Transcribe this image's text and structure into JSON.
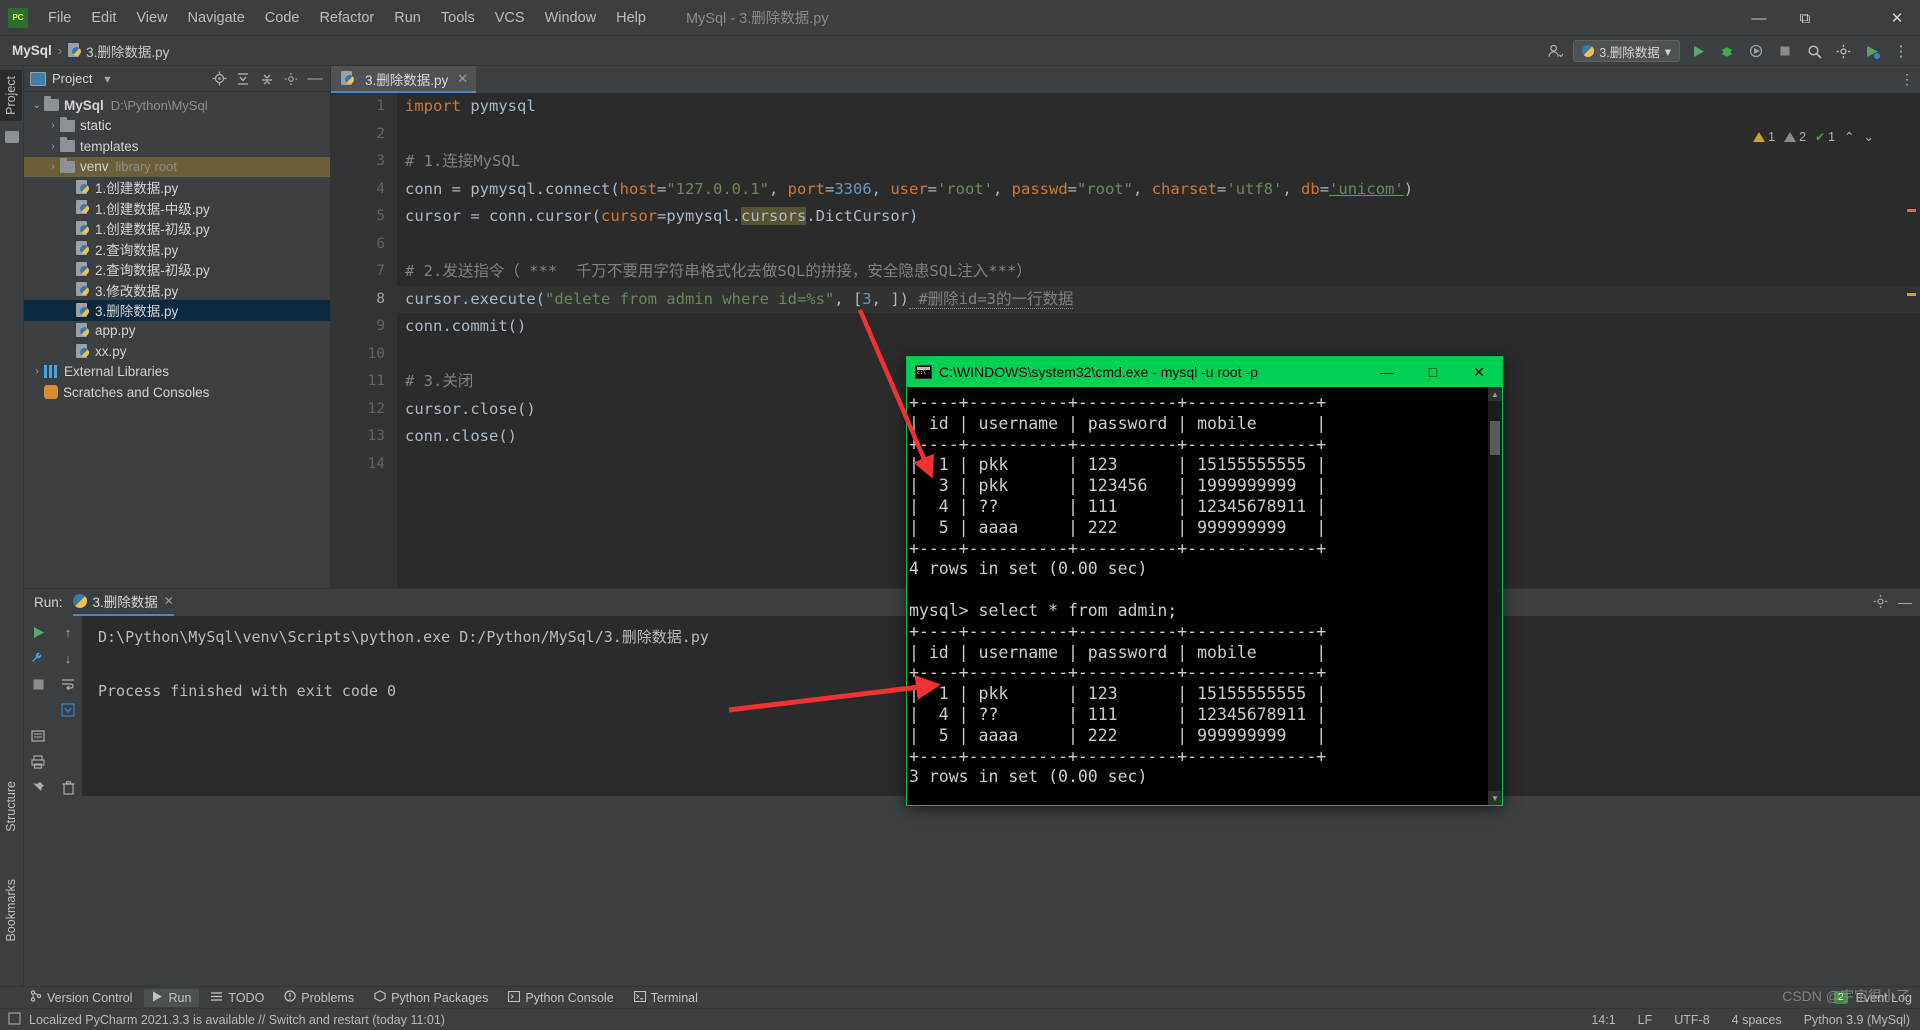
{
  "window": {
    "title": "MySql - 3.删除数据.py",
    "menu": [
      "File",
      "Edit",
      "View",
      "Navigate",
      "Code",
      "Refactor",
      "Run",
      "Tools",
      "VCS",
      "Window",
      "Help"
    ],
    "controls": {
      "minimize": "—",
      "maximize": "□",
      "restore": "⧉",
      "close": "✕"
    }
  },
  "navbar": {
    "breadcrumb_project": "MySql",
    "breadcrumb_sep": "›",
    "breadcrumb_file": "3.删除数据.py",
    "run_config": "3.删除数据",
    "run_config_caret": "▾",
    "icons": {
      "user": "user-icon",
      "run": "▶",
      "debug": "debug-icon",
      "coverage": "coverage-icon",
      "stop": "■",
      "search": "search-icon",
      "settings": "gear-icon",
      "updates": "updates-icon",
      "more": "⋮"
    }
  },
  "left_strip": {
    "tabs": [
      "Project"
    ]
  },
  "left_strip_bottom": {
    "tabs": [
      "Structure",
      "Bookmarks"
    ]
  },
  "project": {
    "title": "Project",
    "caret": "▾",
    "header_icons": [
      "locate-icon",
      "expand-all-icon",
      "collapse-all-icon",
      "settings-icon",
      "hide-icon"
    ],
    "tree": [
      {
        "indent": 0,
        "arrow": "⌄",
        "icon": "folder",
        "label": "MySql",
        "bold": true,
        "sub": "D:\\Python\\MySql",
        "state": "normal"
      },
      {
        "indent": 1,
        "arrow": "›",
        "icon": "folder",
        "label": "static",
        "bold": false,
        "sub": "",
        "state": "normal"
      },
      {
        "indent": 1,
        "arrow": "›",
        "icon": "folder",
        "label": "templates",
        "bold": false,
        "sub": "",
        "state": "normal"
      },
      {
        "indent": 1,
        "arrow": "›",
        "icon": "folder",
        "label": "venv",
        "bold": false,
        "sub": "library root",
        "state": "library"
      },
      {
        "indent": 2,
        "arrow": "",
        "icon": "python",
        "label": "1.创建数据.py",
        "bold": false,
        "sub": "",
        "state": "normal"
      },
      {
        "indent": 2,
        "arrow": "",
        "icon": "python",
        "label": "1.创建数据-中级.py",
        "bold": false,
        "sub": "",
        "state": "normal"
      },
      {
        "indent": 2,
        "arrow": "",
        "icon": "python",
        "label": "1.创建数据-初级.py",
        "bold": false,
        "sub": "",
        "state": "normal"
      },
      {
        "indent": 2,
        "arrow": "",
        "icon": "python",
        "label": "2.查询数据.py",
        "bold": false,
        "sub": "",
        "state": "normal"
      },
      {
        "indent": 2,
        "arrow": "",
        "icon": "python",
        "label": "2.查询数据-初级.py",
        "bold": false,
        "sub": "",
        "state": "normal"
      },
      {
        "indent": 2,
        "arrow": "",
        "icon": "python",
        "label": "3.修改数据.py",
        "bold": false,
        "sub": "",
        "state": "normal"
      },
      {
        "indent": 2,
        "arrow": "",
        "icon": "python",
        "label": "3.删除数据.py",
        "bold": false,
        "sub": "",
        "state": "selected"
      },
      {
        "indent": 2,
        "arrow": "",
        "icon": "python",
        "label": "app.py",
        "bold": false,
        "sub": "",
        "state": "normal"
      },
      {
        "indent": 2,
        "arrow": "",
        "icon": "python",
        "label": "xx.py",
        "bold": false,
        "sub": "",
        "state": "normal"
      },
      {
        "indent": 0,
        "arrow": "›",
        "icon": "library",
        "label": "External Libraries",
        "bold": false,
        "sub": "",
        "state": "normal"
      },
      {
        "indent": 0,
        "arrow": "",
        "icon": "scratch",
        "label": "Scratches and Consoles",
        "bold": false,
        "sub": "",
        "state": "normal"
      }
    ]
  },
  "editor": {
    "tab_label": "3.删除数据.py",
    "tab_close": "✕",
    "gear": "⚙",
    "gutter": [
      "1",
      "2",
      "3",
      "4",
      "5",
      "6",
      "7",
      "8",
      "9",
      "10",
      "11",
      "12",
      "13",
      "14"
    ],
    "current_line_index": 7,
    "inspection": {
      "warnings": "1",
      "weak_warnings": "2",
      "checks": "1",
      "up": "⌃",
      "down": "⌄"
    },
    "lines": [
      [
        {
          "t": "import",
          "c": "k"
        },
        {
          "t": " pymysql",
          "c": "n"
        }
      ],
      [],
      [
        {
          "t": "# 1.连接MySQL",
          "c": "cm"
        }
      ],
      [
        {
          "t": "conn ",
          "c": "n"
        },
        {
          "t": "=",
          "c": "n"
        },
        {
          "t": " pymysql.connect(",
          "c": "n"
        },
        {
          "t": "host",
          "c": "kw"
        },
        {
          "t": "=",
          "c": "n"
        },
        {
          "t": "\"127.0.0.1\"",
          "c": "s"
        },
        {
          "t": ", ",
          "c": "n"
        },
        {
          "t": "port",
          "c": "kw"
        },
        {
          "t": "=",
          "c": "n"
        },
        {
          "t": "3306",
          "c": "num"
        },
        {
          "t": ", ",
          "c": "n"
        },
        {
          "t": "user",
          "c": "kw"
        },
        {
          "t": "=",
          "c": "n"
        },
        {
          "t": "'root'",
          "c": "s"
        },
        {
          "t": ", ",
          "c": "n"
        },
        {
          "t": "passwd",
          "c": "kw"
        },
        {
          "t": "=",
          "c": "n"
        },
        {
          "t": "\"root\"",
          "c": "s"
        },
        {
          "t": ", ",
          "c": "n"
        },
        {
          "t": "charset",
          "c": "kw"
        },
        {
          "t": "=",
          "c": "n"
        },
        {
          "t": "'utf8'",
          "c": "s"
        },
        {
          "t": ", ",
          "c": "n"
        },
        {
          "t": "db",
          "c": "kw"
        },
        {
          "t": "=",
          "c": "n"
        },
        {
          "t": "'unicom'",
          "c": "s underl"
        },
        {
          "t": ")",
          "c": "n"
        }
      ],
      [
        {
          "t": "cursor ",
          "c": "n"
        },
        {
          "t": "=",
          "c": "n"
        },
        {
          "t": " conn.cursor(",
          "c": "n"
        },
        {
          "t": "cursor",
          "c": "kw"
        },
        {
          "t": "=",
          "c": "n"
        },
        {
          "t": "pymysql.",
          "c": "n"
        },
        {
          "t": "cursors",
          "c": "n hl"
        },
        {
          "t": ".DictCursor)",
          "c": "n"
        }
      ],
      [],
      [
        {
          "t": "# 2.发送指令（ ***  千万不要用字符串格式化去做SQL的拼接，安全隐患SQL注入***）",
          "c": "cm"
        }
      ],
      [
        {
          "t": "cursor.execute(",
          "c": "n"
        },
        {
          "t": "\"delete from admin where id=%s\"",
          "c": "s"
        },
        {
          "t": ", ",
          "c": "n"
        },
        {
          "t": "[",
          "c": "n"
        },
        {
          "t": "3",
          "c": "num"
        },
        {
          "t": ", ",
          "c": "n"
        },
        {
          "t": "])",
          "c": "n"
        },
        {
          "t": " #删除id=3的一行数据",
          "c": "cm wavy"
        }
      ],
      [
        {
          "t": "conn.commit()",
          "c": "n"
        }
      ],
      [],
      [
        {
          "t": "# 3.关闭",
          "c": "cm"
        }
      ],
      [
        {
          "t": "cursor.close()",
          "c": "n"
        }
      ],
      [
        {
          "t": "conn.close()",
          "c": "n"
        }
      ],
      []
    ]
  },
  "run_panel": {
    "label": "Run:",
    "tab": "3.删除数据",
    "tab_close": "✕",
    "console": [
      "D:\\Python\\MySql\\venv\\Scripts\\python.exe D:/Python/MySql/3.删除数据.py",
      "",
      "Process finished with exit code 0"
    ],
    "side_icons": [
      "rerun-icon",
      "up-arrow-icon",
      "stop-icon",
      "down-arrow-icon",
      "settings-wrench-icon",
      "soft-wrap-icon",
      "scroll-to-end-icon",
      "print-icon",
      "pin-icon",
      "trash-icon"
    ],
    "header_icons": [
      "gear-icon",
      "hide-icon"
    ]
  },
  "cmd": {
    "title": "C:\\WINDOWS\\system32\\cmd.exe - mysql  -u root -p",
    "minimize": "—",
    "maximize": "□",
    "close": "✕",
    "titlebar_color": "#00d154",
    "scroll_up": "▲",
    "scroll_down": "▼",
    "lines": [
      "+----+----------+----------+-------------+",
      "| id | username | password | mobile      |",
      "+----+----------+----------+-------------+",
      "|  1 | pkk      | 123      | 15155555555 |",
      "|  3 | pkk      | 123456   | 1999999999  |",
      "|  4 | ??       | 111      | 12345678911 |",
      "|  5 | aaaa     | 222      | 999999999   |",
      "+----+----------+----------+-------------+",
      "4 rows in set (0.00 sec)",
      "",
      "mysql> select * from admin;",
      "+----+----------+----------+-------------+",
      "| id | username | password | mobile      |",
      "+----+----------+----------+-------------+",
      "|  1 | pkk      | 123      | 15155555555 |",
      "|  4 | ??       | 111      | 12345678911 |",
      "|  5 | aaaa     | 222      | 999999999   |",
      "+----+----------+----------+-------------+",
      "3 rows in set (0.00 sec)"
    ]
  },
  "bottom_bar": {
    "items": [
      {
        "label": "Version Control",
        "icon": "branch-icon",
        "active": false
      },
      {
        "label": "Run",
        "icon": "play-icon",
        "active": true
      },
      {
        "label": "TODO",
        "icon": "list-icon",
        "active": false
      },
      {
        "label": "Problems",
        "icon": "error-icon",
        "active": false
      },
      {
        "label": "Python Packages",
        "icon": "package-icon",
        "active": false
      },
      {
        "label": "Python Console",
        "icon": "console-icon",
        "active": false
      },
      {
        "label": "Terminal",
        "icon": "terminal-icon",
        "active": false
      }
    ],
    "right": {
      "badge": "2",
      "event_log": "Event Log"
    }
  },
  "status_bar": {
    "message": "Localized PyCharm 2021.3.3 is available // Switch and restart (today 11:01)",
    "caret": "14:1",
    "line_ending": "LF",
    "encoding": "UTF-8",
    "indent": "4 spaces",
    "interpreter": "Python 3.9 (MySql)"
  },
  "watermark": "CSDN @宇宙很小了"
}
